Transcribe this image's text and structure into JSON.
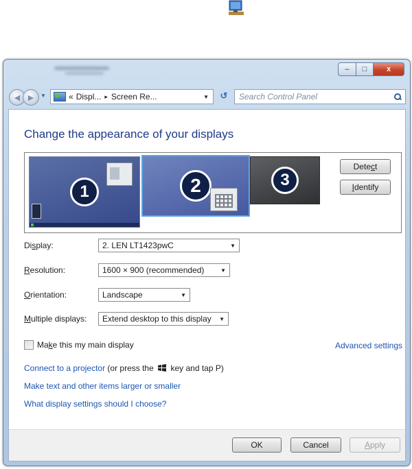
{
  "window": {
    "address_parts": [
      "«",
      "Displ...",
      "▸",
      "Screen Re..."
    ],
    "search_placeholder": "Search Control Panel",
    "caption": {
      "minimize": "–",
      "maximize": "□",
      "close": "x"
    }
  },
  "heading": "Change the appearance of your displays",
  "monitors": [
    {
      "number": "1"
    },
    {
      "number": "2"
    },
    {
      "number": "3"
    }
  ],
  "buttons": {
    "detect": {
      "pre": "Dete",
      "u": "c",
      "post": "t"
    },
    "identify": {
      "pre": "",
      "u": "I",
      "post": "dentify"
    },
    "ok": "OK",
    "cancel": "Cancel",
    "apply": {
      "pre": "",
      "u": "A",
      "post": "pply"
    }
  },
  "fields": {
    "display": {
      "label_pre": "Di",
      "label_u": "s",
      "label_post": "play:",
      "value": "2. LEN LT1423pwC"
    },
    "resolution": {
      "label_pre": "",
      "label_u": "R",
      "label_post": "esolution:",
      "value": "1600 × 900 (recommended)"
    },
    "orientation": {
      "label_pre": "",
      "label_u": "O",
      "label_post": "rientation:",
      "value": "Landscape"
    },
    "multiple": {
      "label_pre": "",
      "label_u": "M",
      "label_post": "ultiple displays:",
      "value": "Extend desktop to this display"
    }
  },
  "main_display": {
    "pre": "Ma",
    "u": "k",
    "post": "e this my main display",
    "checked": false
  },
  "advanced_settings": "Advanced settings",
  "links": {
    "projector_link": "Connect to a projector",
    "projector_text_pre": "(or press the",
    "projector_text_post": "key and tap P)",
    "text_size": "Make text and other items larger or smaller",
    "which_settings": "What display settings should I choose?"
  },
  "icons": {
    "top": "monitor-icon",
    "address": "control-panel-icon",
    "refresh": "refresh-icon",
    "search": "search-icon",
    "windows_key": "windows-logo-icon"
  }
}
